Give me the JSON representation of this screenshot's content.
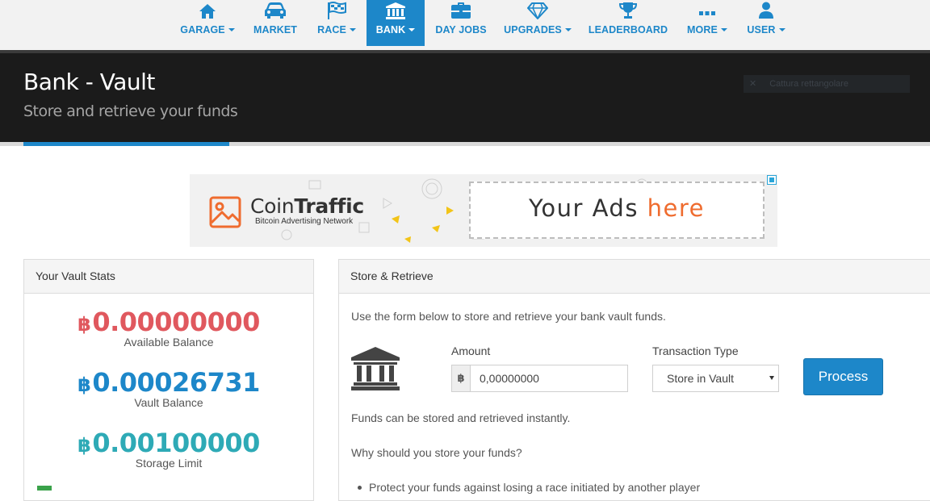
{
  "nav": {
    "items": [
      {
        "label": "GARAGE",
        "icon": "home-icon",
        "dropdown": true
      },
      {
        "label": "MARKET",
        "icon": "car-icon",
        "dropdown": false
      },
      {
        "label": "RACE",
        "icon": "flag-icon",
        "dropdown": true
      },
      {
        "label": "BANK",
        "icon": "bank-icon",
        "dropdown": true,
        "active": true
      },
      {
        "label": "DAY JOBS",
        "icon": "briefcase-icon",
        "dropdown": false
      },
      {
        "label": "UPGRADES",
        "icon": "diamond-icon",
        "dropdown": true
      },
      {
        "label": "LEADERBOARD",
        "icon": "trophy-icon",
        "dropdown": false
      },
      {
        "label": "MORE",
        "icon": "ellipsis-icon",
        "dropdown": true
      },
      {
        "label": "USER",
        "icon": "user-icon",
        "dropdown": true
      }
    ],
    "accent_color": "#1d87c9"
  },
  "header": {
    "title": "Bank - Vault",
    "subtitle": "Store and retrieve your funds",
    "overlay_label": "Cattura rettangolare"
  },
  "ad": {
    "brand_light": "Coin",
    "brand_bold": "Traffic",
    "tagline": "Bitcoin Advertising Network",
    "slot_text": "Your Ads ",
    "slot_highlight": "here"
  },
  "vault_stats": {
    "title": "Your Vault Stats",
    "currency_symbol": "฿",
    "items": [
      {
        "value": "0.00000000",
        "caption": "Available Balance",
        "color": "#e0585e"
      },
      {
        "value": "0.00026731",
        "caption": "Vault Balance",
        "color": "#1d87c9"
      },
      {
        "value": "0.00100000",
        "caption": "Storage Limit",
        "color": "#2eaab6"
      }
    ]
  },
  "store": {
    "title": "Store & Retrieve",
    "intro": "Use the form below to store and retrieve your bank vault funds.",
    "amount_label": "Amount",
    "amount_addon": "฿",
    "amount_value": "0,00000000",
    "type_label": "Transaction Type",
    "type_selected": "Store in Vault",
    "process_label": "Process",
    "note_instant": "Funds can be stored and retrieved instantly.",
    "why_title": "Why should you store your funds?",
    "bullets": [
      "Protect your funds against losing a race initiated by another player"
    ]
  }
}
